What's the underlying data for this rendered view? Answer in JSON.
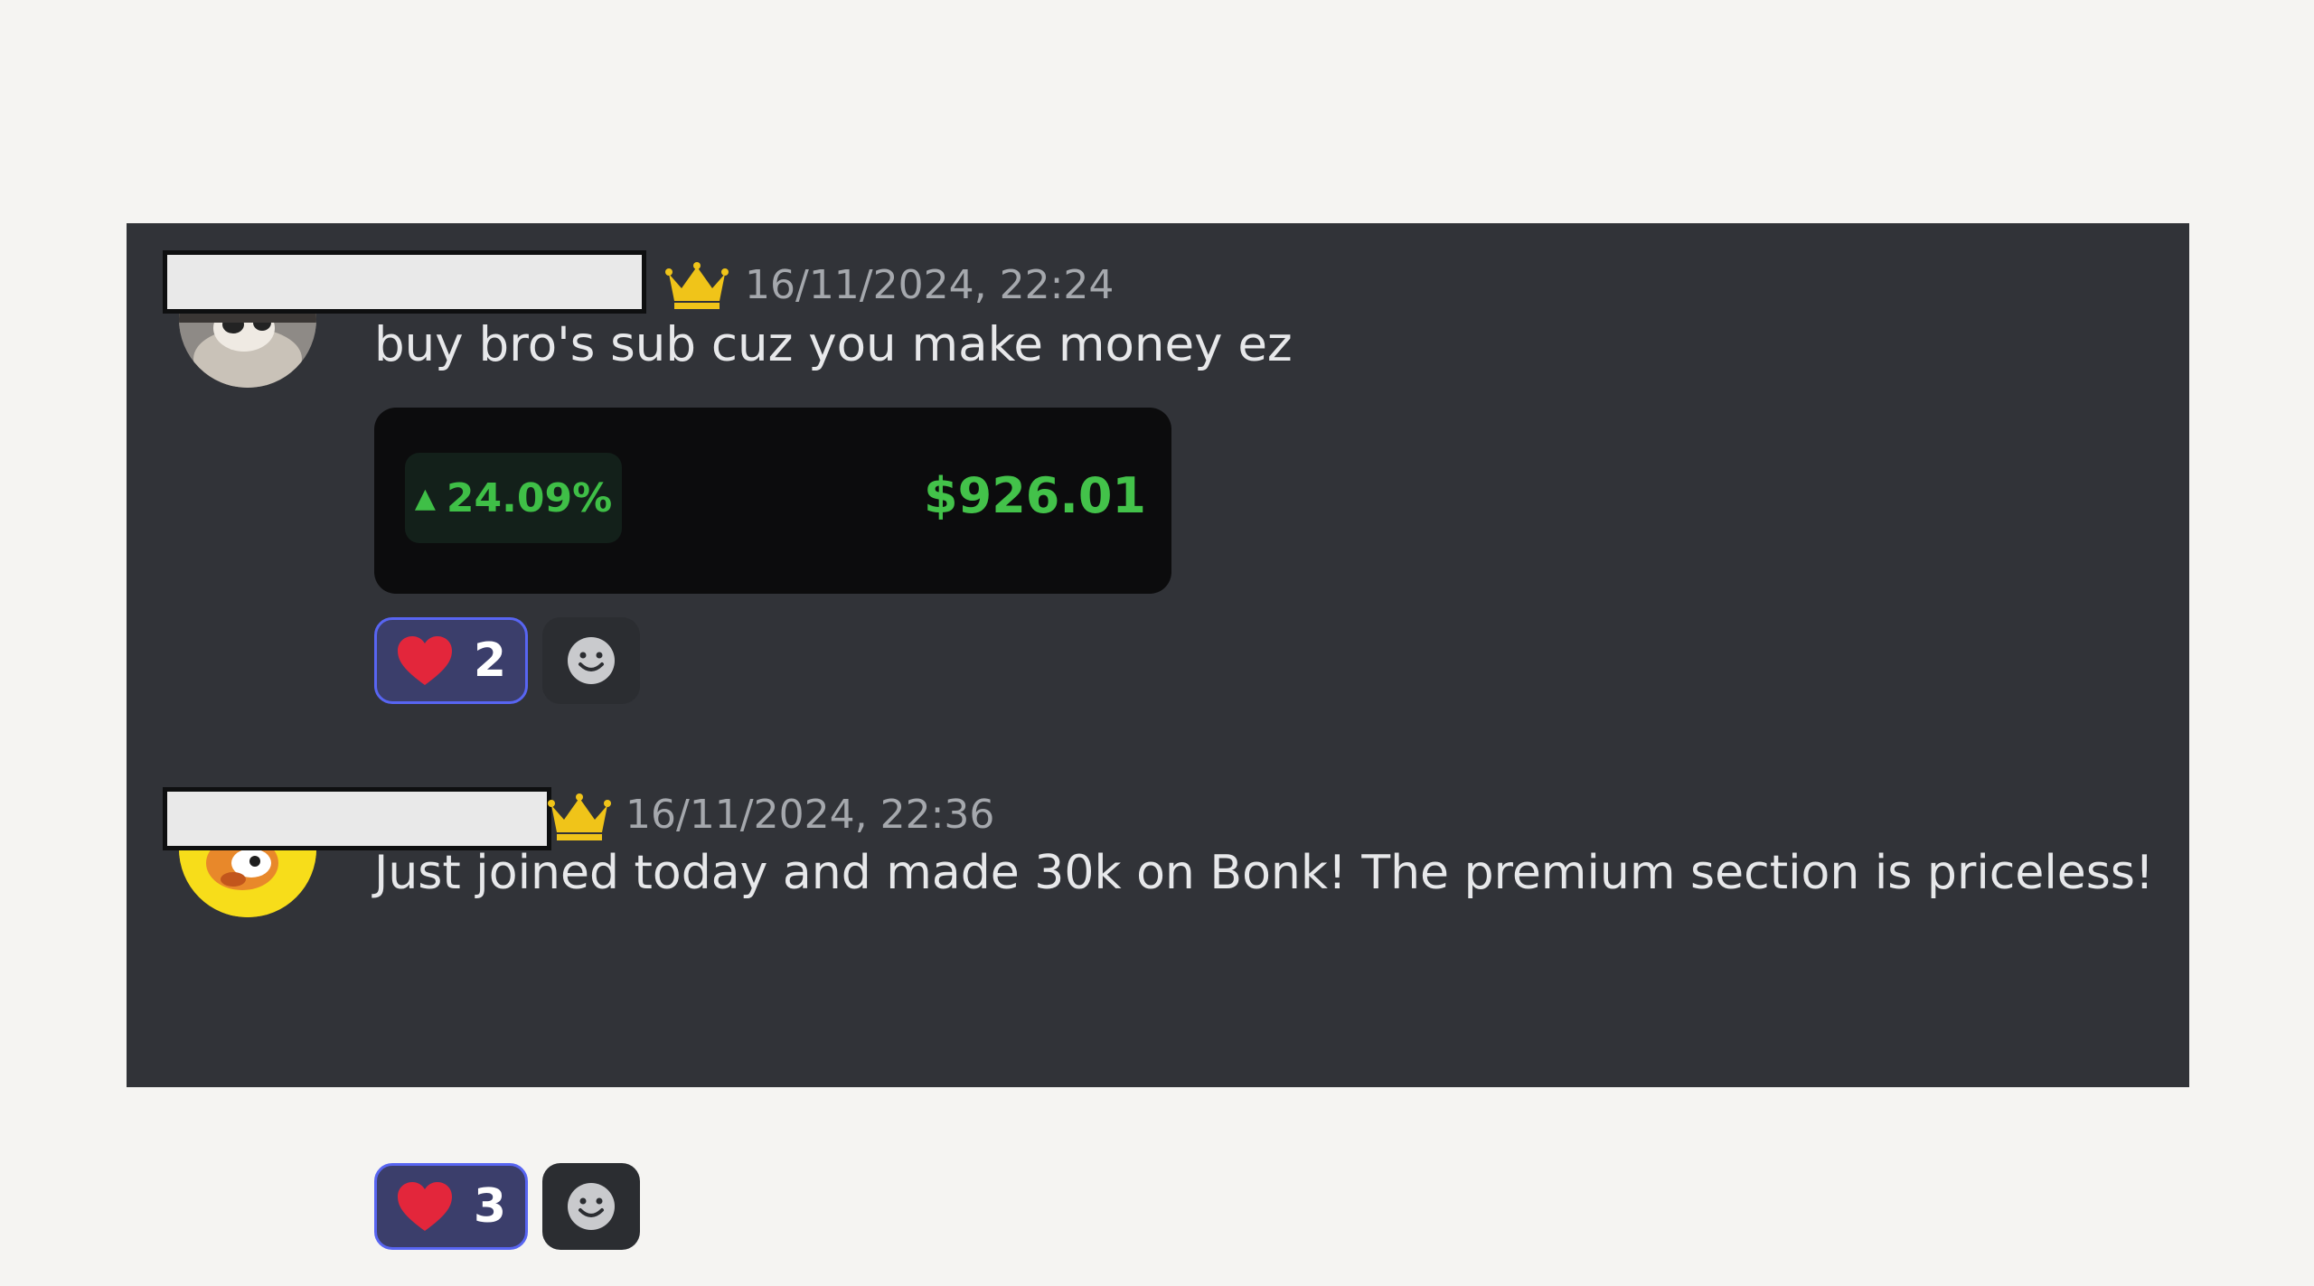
{
  "messages": [
    {
      "timestamp": "16/11/2024, 22:24",
      "content": "buy bro's sub cuz you make money ez",
      "embed": {
        "percent_change": "24.09%",
        "amount": "$926.01"
      },
      "reaction": {
        "emoji": "heart",
        "count": "2"
      }
    },
    {
      "timestamp": "16/11/2024, 22:36",
      "content": "Just joined today and made 30k on Bonk! The premium section is priceless!",
      "reaction": {
        "emoji": "heart",
        "count": "3"
      }
    }
  ],
  "icons": {
    "triangle_up": "▲",
    "crown_color": "#f0c419",
    "heart_color": "#e3263b",
    "gain_color": "#43c24a",
    "reaction_border": "#5865f2"
  }
}
